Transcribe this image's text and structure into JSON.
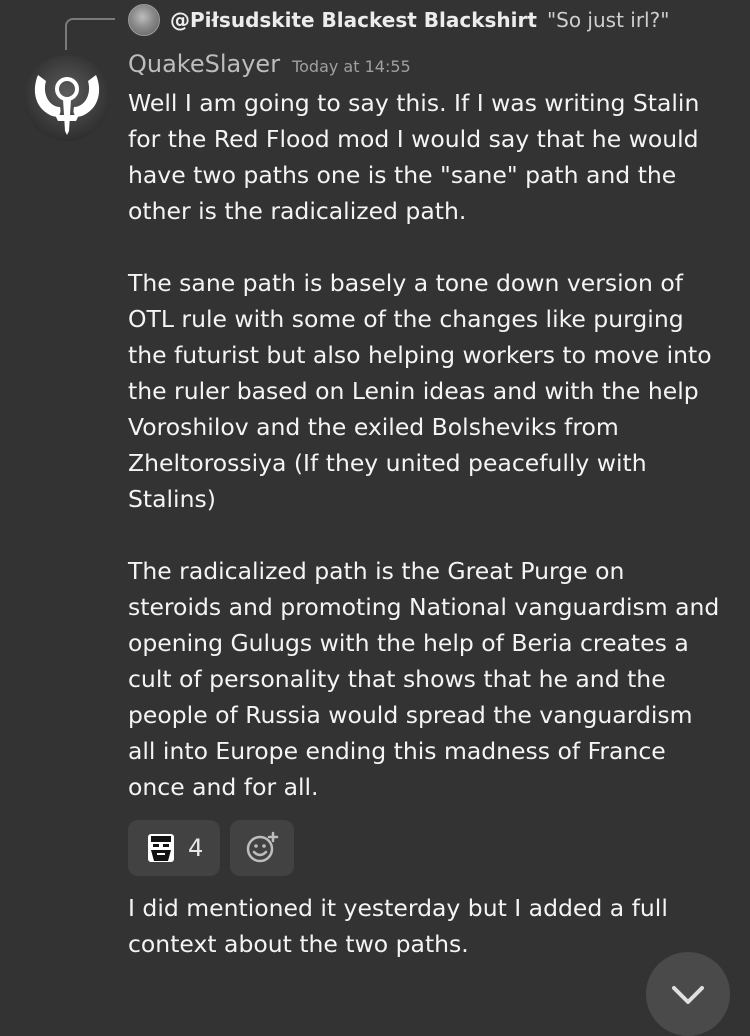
{
  "reply": {
    "author": "@Piłsudskite Blackest Blackshirt",
    "snippet": "\"So just irl?\""
  },
  "message": {
    "username": "QuakeSlayer",
    "timestamp": "Today at 14:55",
    "paragraph1": [
      "Well I am going to say this. If I was writing Stalin",
      "for the Red Flood mod I would say that he would",
      "have two paths one is the \"sane\" path and the",
      "other is the radicalized path."
    ],
    "paragraph2": [
      "The sane path is basely a tone down version of",
      "OTL rule with some of the changes like purging",
      "the futurist but also helping workers to move into",
      "the ruler based on Lenin ideas and with the help",
      "Voroshilov and the exiled Bolsheviks from",
      "Zheltorossiya (If they united peacefully with",
      "Stalins)"
    ],
    "paragraph3": [
      "The radicalized path is the Great Purge on",
      "steroids and promoting National vanguardism and",
      "opening Gulugs with the help of Beria creates a",
      "cult of personality that shows that he and the",
      "people of Russia would spread the vanguardism",
      "all into Europe ending this madness of France",
      "once and for all."
    ]
  },
  "reactions": [
    {
      "icon": "bearded-face-emoji-icon",
      "count": "4"
    }
  ],
  "add_reaction_icon": "add-reaction-icon",
  "followup": [
    "I did mentioned it yesterday but I added a full",
    "context about the two paths."
  ],
  "jump_button_icon": "chevron-down-icon"
}
